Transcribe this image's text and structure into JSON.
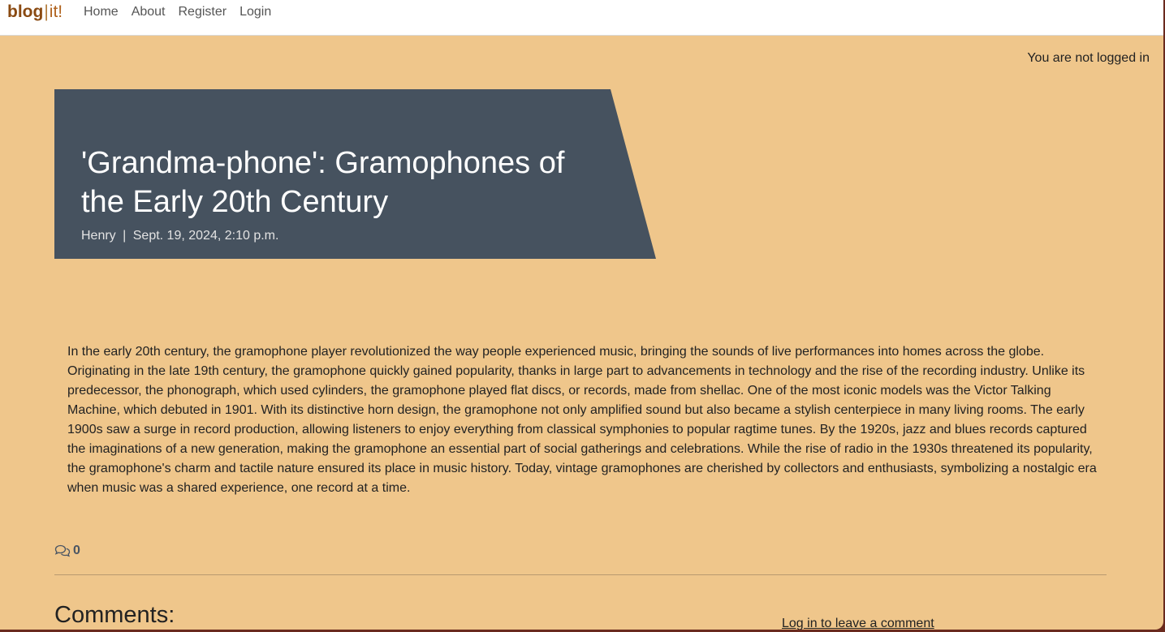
{
  "navbar": {
    "brand_bold": "blog",
    "brand_sep": "|",
    "brand_light": "it!",
    "links": [
      "Home",
      "About",
      "Register",
      "Login"
    ]
  },
  "status": {
    "login": "You are not logged in"
  },
  "post": {
    "title": "'Grandma-phone': Gramophones of the Early 20th Century",
    "author": "Henry",
    "separator": "|",
    "date": "Sept. 19, 2024, 2:10 p.m.",
    "body": "In the early 20th century, the gramophone player revolutionized the way people experienced music, bringing the sounds of live performances into homes across the globe. Originating in the late 19th century, the gramophone quickly gained popularity, thanks in large part to advancements in technology and the rise of the recording industry. Unlike its predecessor, the phonograph, which used cylinders, the gramophone played flat discs, or records, made from shellac. One of the most iconic models was the Victor Talking Machine, which debuted in 1901. With its distinctive horn design, the gramophone not only amplified sound but also became a stylish centerpiece in many living rooms. The early 1900s saw a surge in record production, allowing listeners to enjoy everything from classical symphonies to popular ragtime tunes. By the 1920s, jazz and blues records captured the imaginations of a new generation, making the gramophone an essential part of social gatherings and celebrations. While the rise of radio in the 1930s threatened its popularity, the gramophone's charm and tactile nature ensured its place in music history. Today, vintage gramophones are cherished by collectors and enthusiasts, symbolizing a nostalgic era when music was a shared experience, one record at a time.",
    "comment_count": "0",
    "comment_icon": "chat-bubbles-icon"
  },
  "comments": {
    "heading": "Comments:",
    "login_prompt": "Log in to leave a comment"
  },
  "colors": {
    "page_bg": "#efc68b",
    "hero_bg": "#46525f",
    "brand": "#8a4a12"
  }
}
